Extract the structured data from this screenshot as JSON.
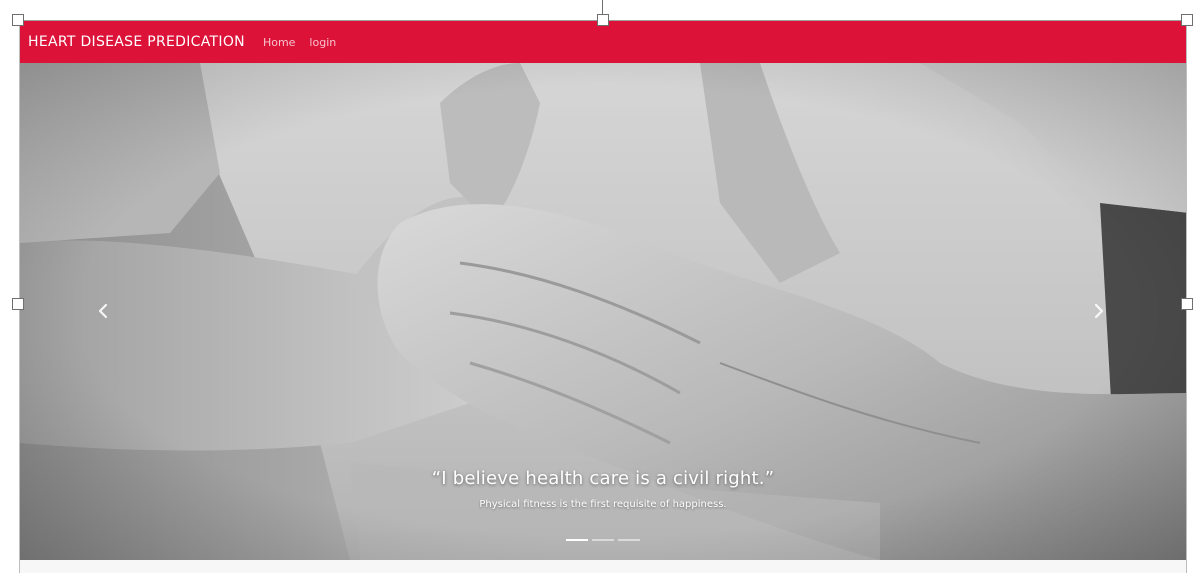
{
  "navbar": {
    "brand": "HEART DISEASE PREDICATION",
    "links": [
      "Home",
      "login"
    ],
    "background_color": "#dc1239"
  },
  "carousel": {
    "image_description_icon": "chest-pain-photo",
    "caption_title": "“I believe health care is a civil right.”",
    "caption_subtitle": "Physical fitness is the first requisite of happiness.",
    "slide_count": 3,
    "active_slide": 1,
    "prev_icon": "chevron-left-icon",
    "next_icon": "chevron-right-icon"
  },
  "editor": {
    "selection_handles": [
      "top-left",
      "top-center",
      "top-right",
      "middle-left",
      "middle-right"
    ],
    "handle_icon": "resize-handle-icon"
  }
}
